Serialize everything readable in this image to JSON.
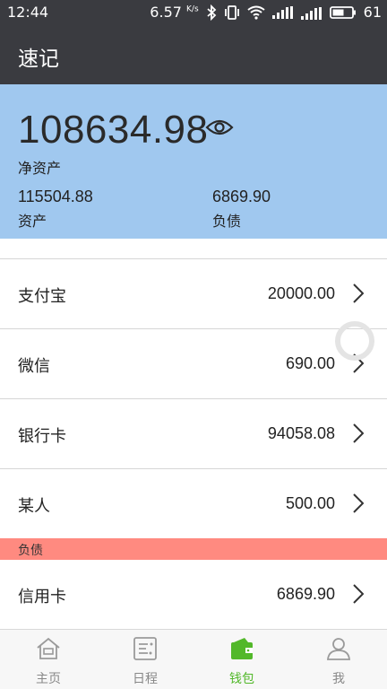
{
  "status_bar": {
    "time": "12:44",
    "speed": "6.57",
    "speed_unit": "K/s",
    "battery": "61"
  },
  "app": {
    "title": "速记"
  },
  "summary": {
    "net_assets_value": "108634.98",
    "net_assets_label": "净资产",
    "assets_value": "115504.88",
    "assets_label": "资产",
    "liabilities_value": "6869.90",
    "liabilities_label": "负债"
  },
  "accounts": [
    {
      "name": "支付宝",
      "amount": "20000.00"
    },
    {
      "name": "微信",
      "amount": "690.00"
    },
    {
      "name": "银行卡",
      "amount": "94058.08"
    },
    {
      "name": "某人",
      "amount": "500.00"
    }
  ],
  "liabilities_section": {
    "header": "负债",
    "items": [
      {
        "name": "信用卡",
        "amount": "6869.90"
      }
    ]
  },
  "tabs": [
    {
      "label": "主页",
      "icon": "home-icon",
      "active": false
    },
    {
      "label": "日程",
      "icon": "schedule-icon",
      "active": false
    },
    {
      "label": "钱包",
      "icon": "wallet-icon",
      "active": true
    },
    {
      "label": "我",
      "icon": "person-icon",
      "active": false
    }
  ],
  "colors": {
    "app_bar": "#3a3b40",
    "summary_bg": "#a0c8ef",
    "liabilities_header": "#ff8a80",
    "active_tab": "#52b82a"
  }
}
